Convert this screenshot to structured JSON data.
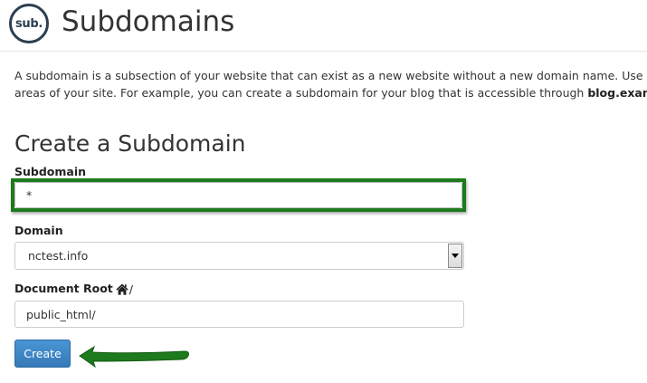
{
  "header": {
    "logo_text": "sub.",
    "title": "Subdomains"
  },
  "description": {
    "line1": "A subdomain is a subsection of your website that can exist as a new website without a new domain name. Use subdomains",
    "line2_prefix": "areas of your site. For example, you can create a subdomain for your blog that is accessible through ",
    "line2_bold": "blog.example.com"
  },
  "form": {
    "section_title": "Create a Subdomain",
    "subdomain_label": "Subdomain",
    "subdomain_value": "*",
    "domain_label": "Domain",
    "domain_selected": "nctest.info",
    "docroot_label": "Document Root",
    "docroot_icon": "home-icon",
    "docroot_slash": "/",
    "docroot_value": "public_html/",
    "create_button": "Create"
  },
  "annotations": {
    "highlight_color": "#1d7a1d",
    "arrow_color": "#1d7a1d",
    "button_color": "#3a85c6"
  }
}
